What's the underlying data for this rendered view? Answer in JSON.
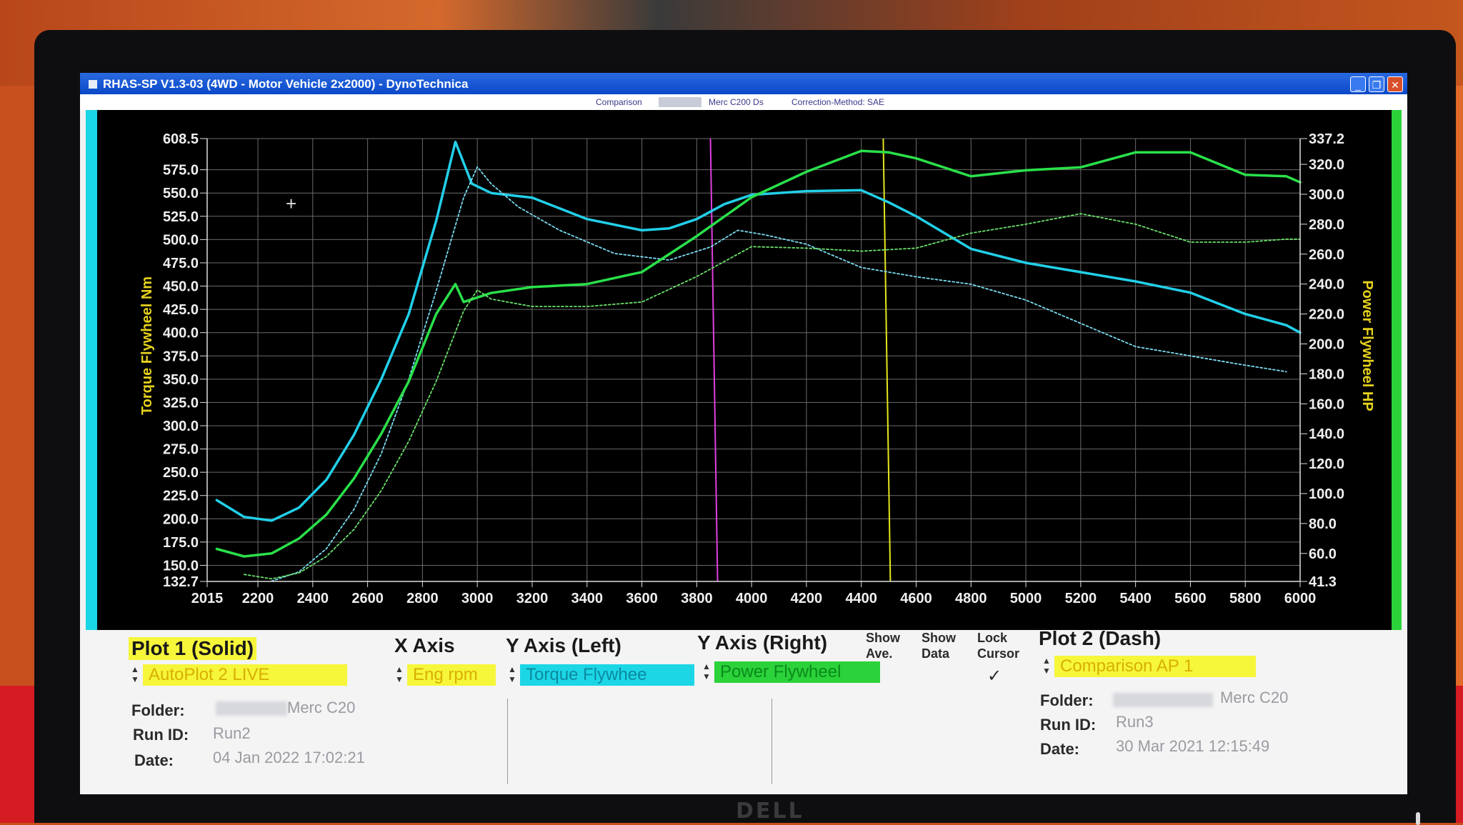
{
  "window": {
    "title": "RHAS-SP V1.3-03  (4WD - Motor Vehicle 2x2000) - DynoTechnica"
  },
  "header": {
    "comparison_label": "Comparison",
    "comparison_value": "Merc C200 Ds",
    "correction_label": "Correction-Method: SAE"
  },
  "monitor": {
    "brand": "DELL"
  },
  "chart_data": {
    "type": "line",
    "xlabel": "",
    "ylabel_left": "Torque Flywheel Nm",
    "ylabel_right": "Power Flywheel HP",
    "xlim": [
      2015,
      6000
    ],
    "ylim_left": [
      132.7,
      608.5
    ],
    "ylim_right": [
      41.3,
      337.2
    ],
    "x_ticks": [
      "2015",
      "2200",
      "2400",
      "2600",
      "2800",
      "3000",
      "3200",
      "3400",
      "3600",
      "3800",
      "4000",
      "4200",
      "4400",
      "4600",
      "4800",
      "5000",
      "5200",
      "5400",
      "5600",
      "5800",
      "6000"
    ],
    "y_left_ticks": [
      "608.5",
      "575.0",
      "550.0",
      "525.0",
      "500.0",
      "475.0",
      "450.0",
      "425.0",
      "400.0",
      "375.0",
      "350.0",
      "325.0",
      "300.0",
      "275.0",
      "250.0",
      "225.0",
      "200.0",
      "175.0",
      "150.0",
      "132.7"
    ],
    "y_right_ticks": [
      "337.2",
      "320.0",
      "300.0",
      "280.0",
      "260.0",
      "240.0",
      "220.0",
      "200.0",
      "180.0",
      "160.0",
      "140.0",
      "120.0",
      "100.0",
      "80.0",
      "60.0",
      "41.3"
    ],
    "cursors": [
      {
        "name": "magenta",
        "x": 3850,
        "color": "#e040e0"
      },
      {
        "name": "yellow",
        "x": 4480,
        "color": "#e6e61e"
      }
    ],
    "series": [
      {
        "axis": "left",
        "style": "solid",
        "color": "#22cfe8",
        "x": [
          2050,
          2150,
          2250,
          2350,
          2450,
          2550,
          2650,
          2750,
          2850,
          2920,
          2980,
          3050,
          3200,
          3400,
          3600,
          3700,
          3800,
          3900,
          4000,
          4200,
          4400,
          4500,
          4600,
          4800,
          5000,
          5200,
          5400,
          5600,
          5800,
          5950,
          6000
        ],
        "y": [
          220,
          202,
          198,
          212,
          242,
          290,
          350,
          420,
          520,
          605,
          560,
          550,
          545,
          522,
          510,
          512,
          522,
          538,
          548,
          552,
          553,
          540,
          525,
          490,
          475,
          465,
          455,
          443,
          420,
          408,
          400
        ]
      },
      {
        "axis": "left",
        "style": "dash",
        "color": "#7adcf0",
        "x": [
          2250,
          2350,
          2450,
          2550,
          2650,
          2750,
          2850,
          2950,
          3000,
          3050,
          3150,
          3300,
          3500,
          3700,
          3850,
          3950,
          4050,
          4200,
          4400,
          4600,
          4800,
          5000,
          5200,
          5400,
          5600,
          5800,
          5950
        ],
        "y": [
          133,
          143,
          168,
          210,
          270,
          350,
          445,
          545,
          578,
          560,
          535,
          510,
          485,
          478,
          492,
          510,
          505,
          495,
          470,
          460,
          452,
          435,
          410,
          385,
          375,
          365,
          358
        ]
      },
      {
        "axis": "right",
        "style": "solid",
        "color": "#2ae04a",
        "x": [
          2050,
          2150,
          2250,
          2350,
          2450,
          2550,
          2650,
          2750,
          2850,
          2920,
          2950,
          3050,
          3200,
          3400,
          3600,
          3800,
          4000,
          4200,
          4400,
          4500,
          4600,
          4800,
          5000,
          5200,
          5400,
          5600,
          5800,
          5950,
          6000
        ],
        "y": [
          63,
          58,
          60,
          70,
          86,
          110,
          140,
          175,
          220,
          240,
          228,
          234,
          238,
          240,
          248,
          272,
          298,
          315,
          329,
          328,
          324,
          312,
          316,
          318,
          328,
          328,
          313,
          312,
          308
        ]
      },
      {
        "axis": "right",
        "style": "dash",
        "color": "#6ae06a",
        "x": [
          2150,
          2250,
          2350,
          2450,
          2550,
          2650,
          2750,
          2850,
          2950,
          3000,
          3050,
          3200,
          3400,
          3600,
          3800,
          4000,
          4200,
          4400,
          4600,
          4800,
          5000,
          5200,
          5400,
          5600,
          5800,
          5950,
          6000
        ],
        "y": [
          46,
          43,
          47,
          58,
          76,
          102,
          135,
          175,
          222,
          236,
          230,
          225,
          225,
          228,
          245,
          265,
          264,
          262,
          264,
          274,
          280,
          287,
          280,
          268,
          268,
          270,
          270
        ]
      }
    ]
  },
  "controls": {
    "plot1": {
      "heading": "Plot 1 (Solid)",
      "selected": "AutoPlot 2 LIVE",
      "folder_label": "Folder:",
      "folder_value": "Merc C20",
      "runid_label": "Run ID:",
      "runid_value": "Run2",
      "date_label": "Date:",
      "date_value": "04 Jan 2022  17:02:21"
    },
    "x_axis": {
      "heading": "X Axis",
      "selected": "Eng rpm"
    },
    "y_left": {
      "heading": "Y Axis (Left)",
      "selected": "Torque Flywhee"
    },
    "y_right": {
      "heading": "Y Axis (Right)",
      "selected": "Power Flywheel"
    },
    "show_ave": "Show Ave.",
    "show_data": "Show Data",
    "lock_cursor": "Lock Cursor",
    "check_mark": "✓",
    "plot2": {
      "heading": "Plot 2 (Dash)",
      "selected": "Comparison AP 1",
      "folder_label": "Folder:",
      "folder_value": "Merc C20",
      "runid_label": "Run ID:",
      "runid_value": "Run3",
      "date_label": "Date:",
      "date_value": "30 Mar 2021  12:15:49"
    }
  }
}
